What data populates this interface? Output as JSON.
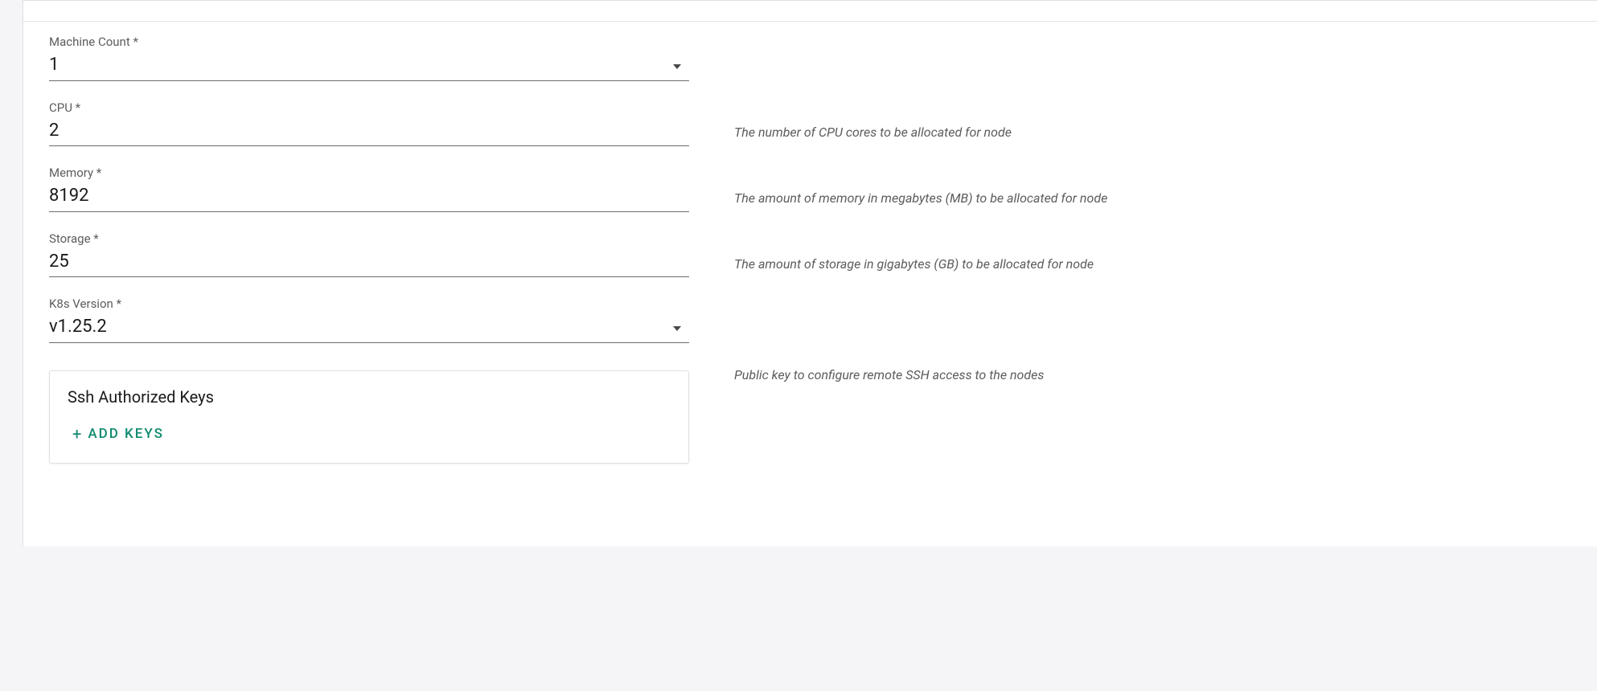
{
  "form": {
    "machineCount": {
      "label": "Machine Count *",
      "value": "1"
    },
    "cpu": {
      "label": "CPU *",
      "value": "2",
      "help": "The number of CPU cores to be allocated for node"
    },
    "memory": {
      "label": "Memory *",
      "value": "8192",
      "help": "The amount of memory in megabytes (MB) to be allocated for node"
    },
    "storage": {
      "label": "Storage *",
      "value": "25",
      "help": "The amount of storage in gigabytes (GB) to be allocated for node"
    },
    "k8sVersion": {
      "label": "K8s Version *",
      "value": "v1.25.2"
    },
    "sshKeys": {
      "title": "Ssh Authorized Keys",
      "addLabel": "ADD  KEYS",
      "help": "Public key to configure remote SSH access to the nodes"
    }
  }
}
